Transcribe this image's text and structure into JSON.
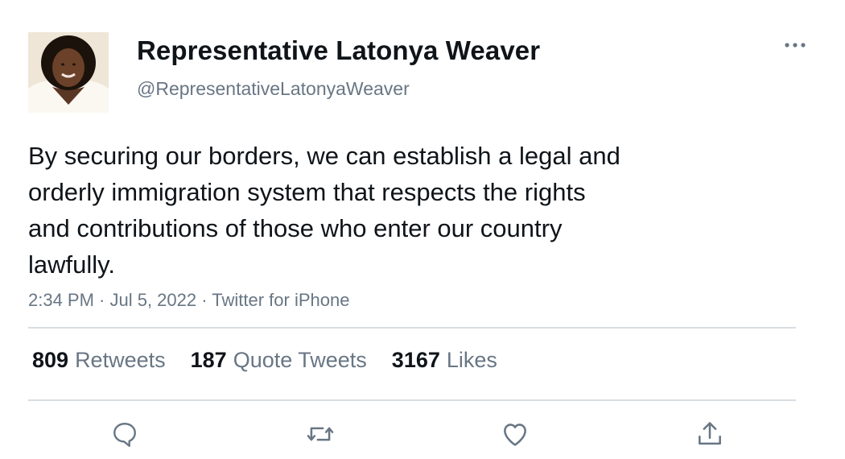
{
  "author": {
    "display_name": "Representative Latonya Weaver",
    "handle": "@RepresentativeLatonyaWeaver"
  },
  "tweet": {
    "lines": [
      "By securing our borders, we can establish a legal and",
      "orderly immigration system that respects the rights",
      "and contributions of those who enter our country",
      "lawfully."
    ],
    "meta": "2:34 PM · Jul 5, 2022 · Twitter for iPhone"
  },
  "stats": {
    "retweets": {
      "count": "809",
      "label": "Retweets"
    },
    "quotes": {
      "count": "187",
      "label": "Quote Tweets"
    },
    "likes": {
      "count": "3167",
      "label": "Likes"
    }
  },
  "icons": {
    "more": "more-horizontal-icon",
    "reply": "reply-icon",
    "retweet": "retweet-icon",
    "like": "heart-icon",
    "share": "share-icon"
  },
  "colors": {
    "text": "#0f1419",
    "secondary": "#687684",
    "divider": "#d9dde1"
  }
}
